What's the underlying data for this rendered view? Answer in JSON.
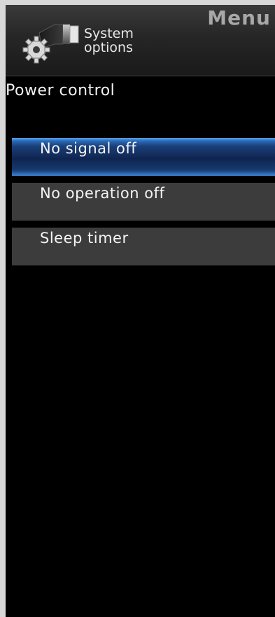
{
  "header": {
    "title": "Menu",
    "category_line1": "System",
    "category_line2": "options",
    "category_icon": "gear-plug-icon"
  },
  "page": {
    "section_title": "Power control"
  },
  "menu": {
    "items": [
      {
        "label": "No signal off",
        "selected": true
      },
      {
        "label": "No operation off",
        "selected": false
      },
      {
        "label": "Sleep timer",
        "selected": false
      }
    ]
  },
  "colors": {
    "background": "#000000",
    "header": "#2a2a2a",
    "item": "#3c3c3c",
    "selected_item": "#1a3f78",
    "selected_edge": "#3f86d8",
    "text": "#f4f4f4"
  }
}
